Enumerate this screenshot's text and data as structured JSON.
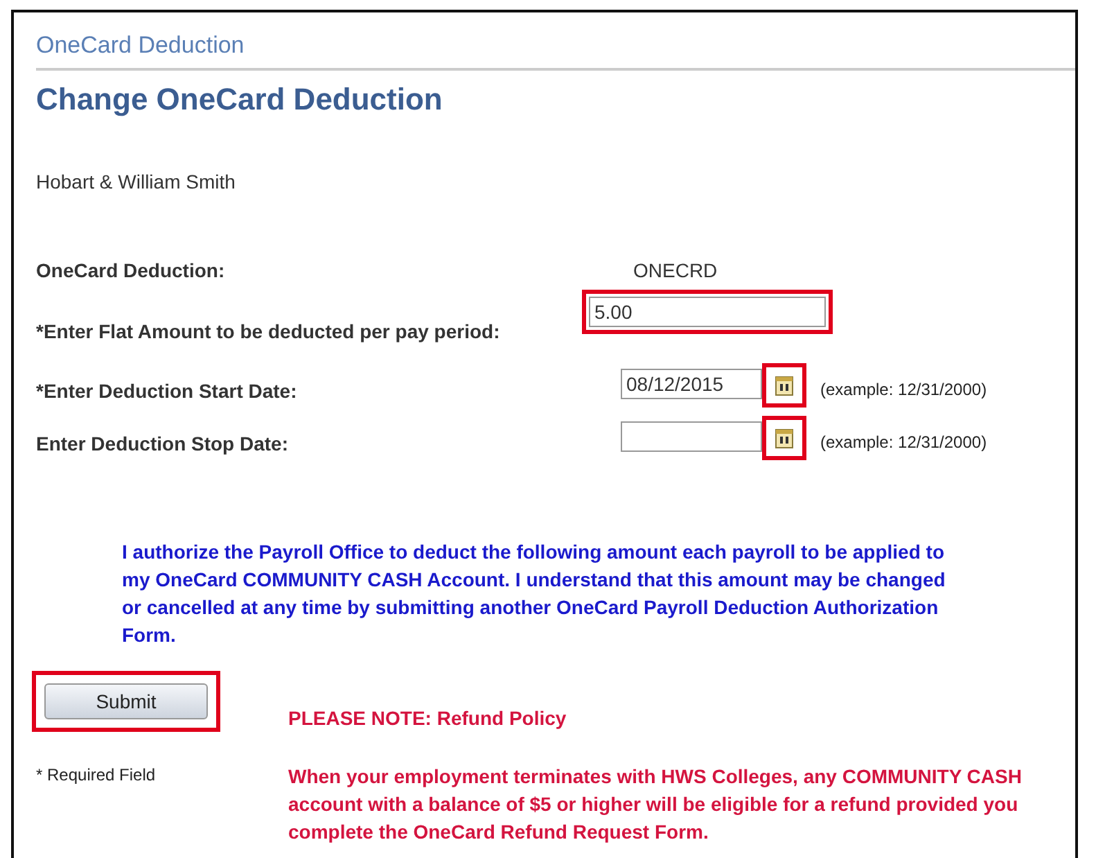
{
  "breadcrumb": "OneCard Deduction",
  "heading": "Change OneCard Deduction",
  "employer": "Hobart & William Smith",
  "fields": [
    {
      "kind": "display",
      "label": "OneCard Deduction:",
      "value": "ONECRD"
    },
    {
      "kind": "amount",
      "label": "*Enter Flat Amount to be deducted per pay period:",
      "value": "5.00",
      "highlighted": true
    },
    {
      "kind": "date",
      "label": "*Enter Deduction Start Date:",
      "value": "08/12/2015",
      "hint": "(example: 12/31/2000)",
      "highlighted": true
    },
    {
      "kind": "date",
      "label": "Enter Deduction Stop Date:",
      "hint": "(example: 12/31/2000)",
      "highlighted": true
    }
  ],
  "authorization": "I authorize the Payroll Office to deduct the following amount each payroll to be applied to my OneCard COMMUNITY CASH Account. I understand that this amount may be changed or cancelled at any time by submitting another OneCard Payroll Deduction Authorization Form.",
  "submit": {
    "label": "Submit",
    "highlighted": true
  },
  "note_title": "PLEASE NOTE: Refund Policy",
  "required_note": "* Required Field",
  "refund_policy": "When your employment terminates with HWS Colleges, any COMMUNITY CASH account with a balance of $5 or higher will be eligible for a refund provided you complete the OneCard Refund Request Form."
}
